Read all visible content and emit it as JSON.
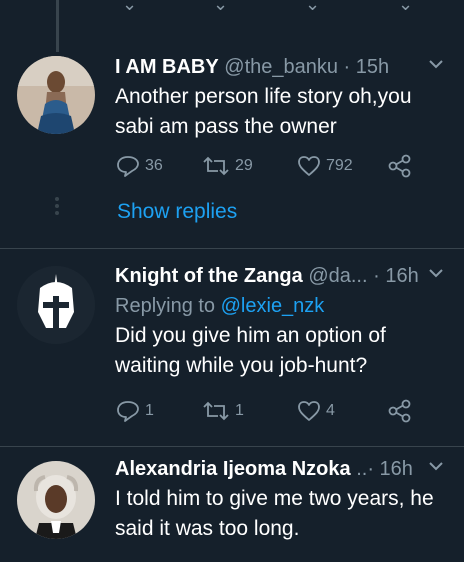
{
  "tweets": [
    {
      "name": "I AM BABY",
      "meta": "@the_banku · 15h",
      "text": "Another person life story oh,you sabi am pass the owner",
      "replies": "36",
      "retweets": "29",
      "likes": "792",
      "show_replies": "Show replies"
    },
    {
      "name": "Knight of the Zanga",
      "meta": "@da... · 16h",
      "replying_prefix": "Replying to",
      "replying_handle": "@lexie_nzk",
      "text": "Did you give him an option of waiting while you job-hunt?",
      "replies": "1",
      "retweets": "1",
      "likes": "4"
    },
    {
      "name": "Alexandria Ijeoma Nzoka",
      "meta": "..· 16h",
      "text": "I told him to give me two years, he said it was too long."
    }
  ],
  "colors": {
    "background": "#15202b",
    "secondary_text": "#8899a6",
    "accent": "#1da1f2",
    "divider": "#38444d"
  }
}
